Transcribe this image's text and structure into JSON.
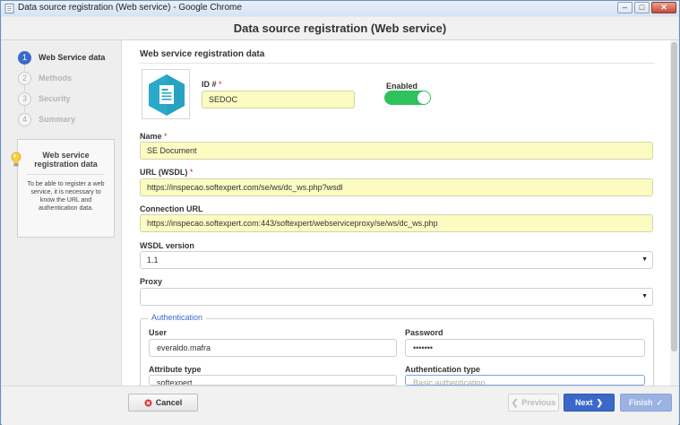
{
  "window": {
    "title": "Data source registration (Web service) - Google Chrome",
    "minimize": "‒",
    "maximize": "□",
    "close": "✕"
  },
  "header": {
    "title": "Data source registration (Web service)"
  },
  "steps": [
    {
      "number": "1",
      "label": "Web Service data",
      "active": true
    },
    {
      "number": "2",
      "label": "Methods",
      "active": false
    },
    {
      "number": "3",
      "label": "Security",
      "active": false
    },
    {
      "number": "4",
      "label": "Summary",
      "active": false
    }
  ],
  "help": {
    "title": "Web service registration data",
    "text": "To be able to register a web service, it is necessary to know the URL and authentication data."
  },
  "form": {
    "section_title": "Web service registration data",
    "id_label": "ID #",
    "id_required": "*",
    "id_value": "SEDOC",
    "enabled_label": "Enabled",
    "enabled": true,
    "name_label": "Name",
    "name_required": "*",
    "name_value": "SE Document",
    "url_label": "URL (WSDL)",
    "url_required": "*",
    "url_value": "https://inspecao.softexpert.com/se/ws/dc_ws.php?wsdl",
    "conn_label": "Connection URL",
    "conn_value": "https://inspecao.softexpert.com:443/softexpert/webserviceproxy/se/ws/dc_ws.php",
    "wsdl_label": "WSDL version",
    "wsdl_value": "1.1",
    "proxy_label": "Proxy",
    "proxy_value": "",
    "auth_legend": "Authentication",
    "user_label": "User",
    "user_value": "everaldo.mafra",
    "password_label": "Password",
    "password_value": "•••••••",
    "attr_label": "Attribute type",
    "attr_value": "softexpert",
    "authtype_label": "Authentication type",
    "authtype_value": "Basic authentication"
  },
  "footer": {
    "cancel": "Cancel",
    "previous": "Previous",
    "next": "Next",
    "finish": "Finish"
  },
  "colors": {
    "accent": "#3b69c9",
    "required_field_bg": "#fbfbc2",
    "toggle_on": "#2fc25c",
    "icon_hex": "#2aa9c9"
  }
}
